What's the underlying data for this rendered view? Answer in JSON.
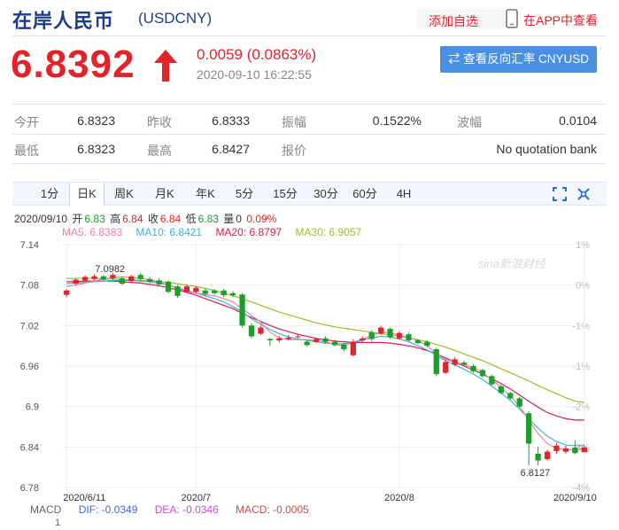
{
  "header": {
    "title": "在岸人民币",
    "symbol": "(USDCNY)",
    "add_watch": "添加自选",
    "app_view": "在APP中查看"
  },
  "quote": {
    "price": "6.8392",
    "change": "0.0059 (0.0863%)",
    "time": "2020-09-10 16:22:55",
    "reverse_button": "⇄ 查看反向汇率 CNYUSD",
    "colors": {
      "up": "#e2232a",
      "down": "#1a9f29",
      "accent": "#4a90e2"
    }
  },
  "stats": {
    "row1": [
      {
        "label": "今开",
        "value": "6.8323"
      },
      {
        "label": "昨收",
        "value": "6.8333"
      },
      {
        "label": "振幅",
        "value": "0.1522%"
      },
      {
        "label": "波幅",
        "value": "0.0104"
      }
    ],
    "row2": [
      {
        "label": "最低",
        "value": "6.8323"
      },
      {
        "label": "最高",
        "value": "6.8427"
      },
      {
        "label": "报价",
        "value": "No quotation bank"
      }
    ]
  },
  "tabs": [
    "1分",
    "日K",
    "周K",
    "月K",
    "年K",
    "5分",
    "15分",
    "30分",
    "60分",
    "4H"
  ],
  "active_tab": "日K",
  "icons": [
    "fullscreen-icon",
    "settings-icon",
    "up-arrow-icon",
    "phone-icon"
  ],
  "info": {
    "date": "2020/09/10",
    "open_label": "开",
    "open": "6.83",
    "high_label": "高",
    "high": "6.84",
    "close_label": "收",
    "close": "6.84",
    "low_label": "低",
    "low": "6.83",
    "volume_label": "量",
    "volume": "0",
    "pct": "0.09%"
  },
  "ma": {
    "ma5": "MA5: 6.8383",
    "ma10": "MA10: 6.8421",
    "ma20": "MA20: 6.8797",
    "ma30": "MA30: 6.9057",
    "colors": {
      "ma5": "#e8839d",
      "ma10": "#3fb2d9",
      "ma20": "#d8204f",
      "ma30": "#9bbf2a"
    }
  },
  "macd": {
    "label": "MACD",
    "dif": "DIF: -0.0349",
    "dea": "DEA: -0.0346",
    "macd": "MACD: -0.0005",
    "axis_value": "1",
    "colors": {
      "dif": "#4a67c9",
      "dea": "#c94ac9",
      "macd": "#c94a4a"
    }
  },
  "watermark": "sina新浪财经",
  "chart_data": {
    "type": "candlestick",
    "y_ticks": [
      "7.14",
      "7.08",
      "7.02",
      "6.96",
      "6.9",
      "6.84",
      "6.78"
    ],
    "y_tick_values": [
      7.14,
      7.08,
      7.02,
      6.96,
      6.9,
      6.84,
      6.78
    ],
    "pct_ticks": [
      "1%",
      "0%",
      "-1%",
      "-1%",
      "-2%",
      "-3%",
      "-4%"
    ],
    "x_labels": [
      "2020/6/11",
      "2020/7",
      "2020/8",
      "2020/9/10"
    ],
    "x_label_index": [
      0,
      14,
      36,
      56
    ],
    "ylim": [
      6.78,
      7.14
    ],
    "annotations": [
      {
        "text": "7.0982",
        "index": 5,
        "value": 7.0982
      },
      {
        "text": "6.8127",
        "index": 51,
        "value": 6.8127
      }
    ],
    "candles": [
      [
        7.0655,
        7.072,
        7.074,
        7.0625
      ],
      [
        7.082,
        7.088,
        7.09,
        7.08
      ],
      [
        7.087,
        7.092,
        7.0945,
        7.085
      ],
      [
        7.089,
        7.093,
        7.096,
        7.087
      ],
      [
        7.093,
        7.088,
        7.095,
        7.086
      ],
      [
        7.09,
        7.095,
        7.0982,
        7.088
      ],
      [
        7.09,
        7.082,
        7.093,
        7.08
      ],
      [
        7.086,
        7.093,
        7.095,
        7.084
      ],
      [
        7.095,
        7.089,
        7.098,
        7.086
      ],
      [
        7.089,
        7.085,
        7.092,
        7.083
      ],
      [
        7.087,
        7.081,
        7.09,
        7.079
      ],
      [
        7.085,
        7.07,
        7.087,
        7.068
      ],
      [
        7.078,
        7.064,
        7.08,
        7.061
      ],
      [
        7.07,
        7.078,
        7.081,
        7.068
      ],
      [
        7.07,
        7.076,
        7.078,
        7.068
      ],
      [
        7.072,
        7.067,
        7.075,
        7.064
      ],
      [
        7.072,
        7.068,
        7.074,
        7.066
      ],
      [
        7.072,
        7.065,
        7.074,
        7.062
      ],
      [
        7.068,
        7.065,
        7.071,
        7.062
      ],
      [
        7.066,
        7.02,
        7.068,
        7.017
      ],
      [
        7.02,
        7.004,
        7.023,
        7.001
      ],
      [
        7.008,
        7.017,
        7.02,
        7.006
      ],
      [
        7.0,
        6.998,
        7.002,
        6.99
      ],
      [
        6.998,
        7.001,
        7.004,
        6.995
      ],
      [
        7.0,
        7.002,
        7.006,
        6.998
      ],
      [
        7.003,
        7.004,
        7.007,
        7.001
      ],
      [
        6.996,
        6.991,
        6.998,
        6.989
      ],
      [
        6.996,
        7.0,
        7.002,
        6.994
      ],
      [
        7.001,
        6.996,
        7.004,
        6.993
      ],
      [
        6.996,
        6.991,
        6.999,
        6.989
      ],
      [
        6.992,
        6.985,
        6.994,
        6.982
      ],
      [
        6.976,
        6.996,
        7.0,
        6.974
      ],
      [
        6.998,
        7.001,
        7.004,
        6.996
      ],
      [
        7.01,
        7.0,
        7.013,
        6.997
      ],
      [
        7.008,
        7.017,
        7.02,
        7.006
      ],
      [
        7.015,
        7.003,
        7.017,
        7.0
      ],
      [
        7.001,
        7.009,
        7.012,
        6.999
      ],
      [
        7.007,
        6.998,
        7.01,
        6.996
      ],
      [
        6.998,
        6.994,
        7.0,
        6.992
      ],
      [
        6.996,
        6.99,
        6.998,
        6.988
      ],
      [
        6.985,
        6.948,
        6.987,
        6.945
      ],
      [
        6.95,
        6.966,
        6.969,
        6.948
      ],
      [
        6.962,
        6.97,
        6.973,
        6.96
      ],
      [
        6.965,
        6.962,
        6.968,
        6.96
      ],
      [
        6.96,
        6.952,
        6.963,
        6.95
      ],
      [
        6.954,
        6.945,
        6.956,
        6.943
      ],
      [
        6.945,
        6.933,
        6.947,
        6.931
      ],
      [
        6.93,
        6.92,
        6.932,
        6.918
      ],
      [
        6.92,
        6.912,
        6.922,
        6.91
      ],
      [
        6.912,
        6.9,
        6.914,
        6.898
      ],
      [
        6.89,
        6.845,
        6.893,
        6.8127
      ],
      [
        6.83,
        6.82,
        6.84,
        6.8127
      ],
      [
        6.822,
        6.833,
        6.836,
        6.82
      ],
      [
        6.834,
        6.842,
        6.846,
        6.83
      ],
      [
        6.833,
        6.838,
        6.842,
        6.83
      ],
      [
        6.839,
        6.831,
        6.85,
        6.829
      ],
      [
        6.8323,
        6.8392,
        6.8427,
        6.8323
      ]
    ],
    "ma5_path": [
      7.078,
      7.08,
      7.083,
      7.086,
      7.089,
      7.091,
      7.092,
      7.091,
      7.09,
      7.088,
      7.085,
      7.08,
      7.075,
      7.07,
      7.068,
      7.066,
      7.064,
      7.06,
      7.055,
      7.045,
      7.035,
      7.025,
      7.01,
      7.002,
      6.999,
      6.999,
      6.999,
      6.998,
      6.996,
      6.992,
      6.99,
      6.995,
      7.0,
      7.005,
      7.01,
      7.009,
      7.006,
      7.002,
      6.998,
      6.99,
      6.978,
      6.97,
      6.966,
      6.962,
      6.958,
      6.95,
      6.94,
      6.928,
      6.916,
      6.9,
      6.88,
      6.86,
      6.845,
      6.838,
      6.836,
      6.836,
      6.838
    ],
    "ma10_path": [
      7.082,
      7.083,
      7.084,
      7.085,
      7.086,
      7.087,
      7.087,
      7.087,
      7.086,
      7.085,
      7.083,
      7.08,
      7.076,
      7.072,
      7.068,
      7.064,
      7.06,
      7.055,
      7.048,
      7.04,
      7.03,
      7.022,
      7.014,
      7.008,
      7.003,
      7.0,
      6.998,
      6.996,
      6.994,
      6.993,
      6.993,
      6.995,
      6.998,
      7.002,
      7.004,
      7.003,
      7.0,
      6.996,
      6.99,
      6.984,
      6.976,
      6.968,
      6.962,
      6.955,
      6.948,
      6.94,
      6.93,
      6.92,
      6.909,
      6.896,
      6.882,
      6.868,
      6.856,
      6.848,
      6.843,
      6.842,
      6.842
    ],
    "ma20_path": [
      7.085,
      7.085,
      7.086,
      7.086,
      7.086,
      7.086,
      7.085,
      7.084,
      7.083,
      7.081,
      7.079,
      7.076,
      7.073,
      7.069,
      7.065,
      7.06,
      7.055,
      7.05,
      7.045,
      7.038,
      7.032,
      7.026,
      7.02,
      7.015,
      7.011,
      7.007,
      7.004,
      7.001,
      6.999,
      6.997,
      6.996,
      6.995,
      6.995,
      6.995,
      6.995,
      6.994,
      6.992,
      6.99,
      6.987,
      6.983,
      6.978,
      6.972,
      6.966,
      6.96,
      6.954,
      6.948,
      6.941,
      6.934,
      6.926,
      6.917,
      6.908,
      6.899,
      6.891,
      6.886,
      6.882,
      6.88,
      6.88
    ],
    "ma30_path": [
      7.09,
      7.09,
      7.09,
      7.09,
      7.089,
      7.089,
      7.088,
      7.088,
      7.087,
      7.086,
      7.085,
      7.084,
      7.082,
      7.08,
      7.078,
      7.075,
      7.072,
      7.068,
      7.064,
      7.06,
      7.055,
      7.05,
      7.045,
      7.04,
      7.036,
      7.032,
      7.028,
      7.024,
      7.021,
      7.018,
      7.016,
      7.014,
      7.012,
      7.01,
      7.008,
      7.006,
      7.004,
      7.002,
      6.999,
      6.996,
      6.992,
      6.988,
      6.983,
      6.978,
      6.973,
      6.968,
      6.962,
      6.956,
      6.95,
      6.944,
      6.938,
      6.931,
      6.925,
      6.919,
      6.913,
      6.908,
      6.906
    ]
  }
}
